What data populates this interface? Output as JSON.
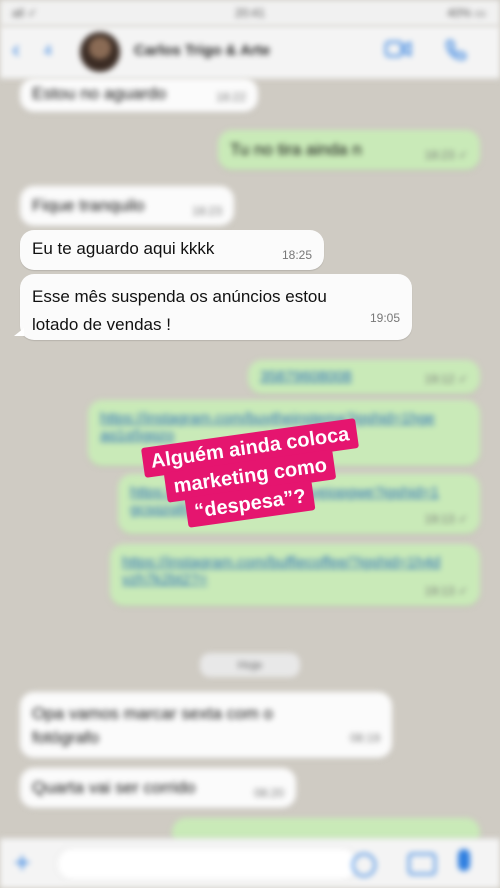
{
  "status_bar": {
    "left": "all ✓",
    "time": "20:41",
    "right": "40% ▭"
  },
  "header": {
    "back_count": "4",
    "contact_name": "Carlos Trigo & Arte"
  },
  "messages": {
    "m1": {
      "text": "Estou no aguardo",
      "time": "18:22"
    },
    "m2": {
      "text": "Tu no tira ainda n",
      "time": "18:23 ✓"
    },
    "m3": {
      "text": "Fique tranquilo",
      "time": "18:23"
    },
    "m4": {
      "text": "Eu te aguardo aqui kkkk",
      "time": "18:25"
    },
    "m5": {
      "text": "Esse mês suspenda os anúncios estou lotado de vendas !",
      "time": "19:05"
    },
    "m6": {
      "text": "35879608008",
      "time": "19:12 ✓"
    },
    "m7": {
      "text": "https://instagram.com/buytheinstema?igshid=1hgeaq1q5gqzo",
      "time": ""
    },
    "m8": {
      "text": "https://instagram.com/p/rusyeiopgwe?igshid=1gcsqzq8ypqr",
      "time": "19:13 ✓"
    },
    "m9": {
      "text": "https://instagram.com/buffiecoffee/?igshid=1h4dvzh7k2bt2?=",
      "time": "19:13 ✓"
    },
    "date_chip": "Hoje",
    "m10": {
      "text": "Opa vamos marcar sexta com o fotógrafo",
      "time": "08:19"
    },
    "m11": {
      "text": "Quarta vai ser corrido",
      "time": "08:20"
    }
  },
  "caption": {
    "line1": "Alguém ainda coloca",
    "line2": "marketing como",
    "line3": "“despesa”?"
  },
  "colors": {
    "caption_bg": "#e5156f",
    "accent": "#2f7fe0",
    "outgoing_bubble": "#c9eab8"
  }
}
